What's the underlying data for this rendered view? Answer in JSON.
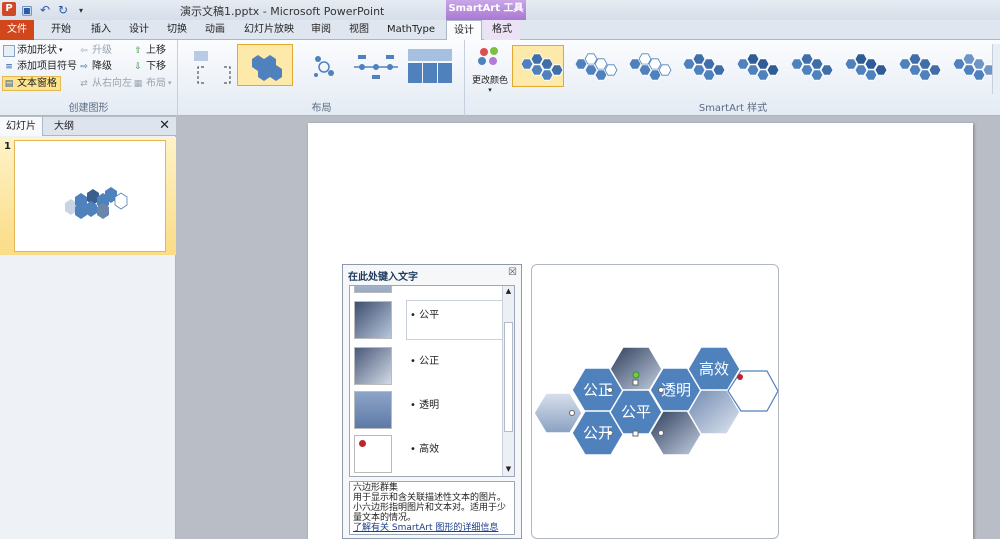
{
  "window": {
    "title": "演示文稿1.pptx - Microsoft PowerPoint",
    "context_tab_label": "SmartArt 工具",
    "app_icon_letter": "P"
  },
  "tabs": [
    {
      "label": "文件",
      "state": "file"
    },
    {
      "label": "开始",
      "state": ""
    },
    {
      "label": "插入",
      "state": ""
    },
    {
      "label": "设计",
      "state": ""
    },
    {
      "label": "切换",
      "state": ""
    },
    {
      "label": "动画",
      "state": ""
    },
    {
      "label": "幻灯片放映",
      "state": ""
    },
    {
      "label": "审阅",
      "state": ""
    },
    {
      "label": "视图",
      "state": ""
    },
    {
      "label": "MathType",
      "state": ""
    },
    {
      "label": "设计",
      "state": "active"
    },
    {
      "label": "格式",
      "state": "ctx"
    }
  ],
  "ribbon": {
    "create_graphic": {
      "label": "创建图形",
      "add_shape": "添加形状",
      "add_bullet": "添加项目符号",
      "text_pane": "文本窗格",
      "promote": "升级",
      "demote": "降级",
      "rtl": "从右向左",
      "move_up": "上移",
      "move_down": "下移",
      "layout_btn": "布局"
    },
    "layouts": {
      "label": "布局"
    },
    "styles": {
      "label": "SmartArt 样式",
      "change_colors": "更改颜色"
    }
  },
  "left_pane": {
    "tab_slides": "幻灯片",
    "tab_outline": "大纲",
    "close": "✕",
    "slide_number": "1"
  },
  "text_pane": {
    "title": "在此处键入文字",
    "close": "☒",
    "items": [
      {
        "text": "公平"
      },
      {
        "text": "公正"
      },
      {
        "text": "透明"
      },
      {
        "text": "高效"
      }
    ],
    "desc_title": "六边形群集",
    "desc_body": "用于显示和含关联描述性文本的图片。小六边形指明图片和文本对。适用于少量文本的情况。",
    "desc_link": "了解有关 SmartArt 图形的详细信息"
  },
  "smartart": {
    "labels": [
      "公正",
      "公平",
      "透明",
      "高效",
      "公开"
    ]
  },
  "colors": {
    "hex_fill": "#4f81bd",
    "file_tab": "#d2461c",
    "selected": "#fde9a9"
  }
}
